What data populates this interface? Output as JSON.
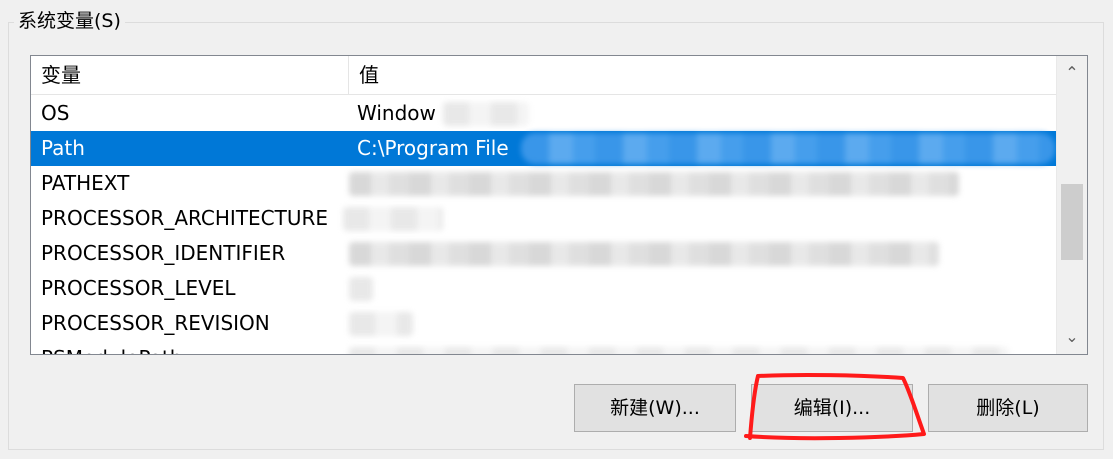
{
  "groupbox": {
    "title": "系统变量(S)"
  },
  "list": {
    "columns": [
      "变量",
      "值"
    ],
    "rows": [
      {
        "name": "OS",
        "value": "Window"
      },
      {
        "name": "Path",
        "value": "C:\\Program File",
        "selected": true
      },
      {
        "name": "PATHEXT",
        "value": ""
      },
      {
        "name": "PROCESSOR_ARCHITECTURE",
        "value": ""
      },
      {
        "name": "PROCESSOR_IDENTIFIER",
        "value": ""
      },
      {
        "name": "PROCESSOR_LEVEL",
        "value": ""
      },
      {
        "name": "PROCESSOR_REVISION",
        "value": ""
      },
      {
        "name": "PSModulePath",
        "value": ""
      }
    ]
  },
  "buttons": {
    "new_label": "新建(W)...",
    "edit_label": "编辑(I)...",
    "delete_label": "删除(L)"
  },
  "scrollbar": {
    "up_arrow": "⌃",
    "down_arrow": "⌄"
  },
  "colors": {
    "selection": "#0078d7",
    "annotation": "#ff0000"
  },
  "icons": {
    "scroll_up": "chevron-up-icon",
    "scroll_down": "chevron-down-icon"
  }
}
